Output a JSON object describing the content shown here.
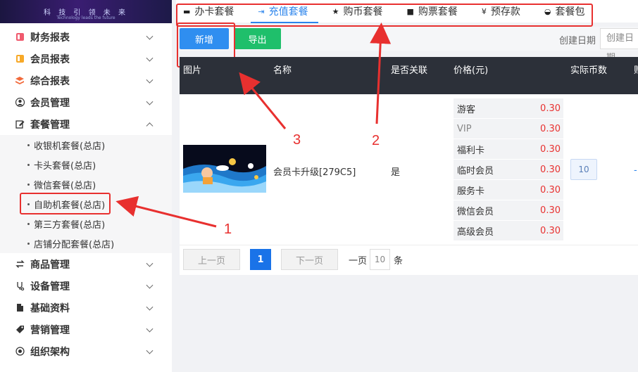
{
  "banner": {
    "title": "科 技 引 领 未 来",
    "subtitle": "Technology leads the future"
  },
  "sidebar": {
    "items": [
      {
        "label": "财务报表",
        "icon": "report-icon"
      },
      {
        "label": "会员报表",
        "icon": "member-report-icon"
      },
      {
        "label": "综合报表",
        "icon": "layers-icon"
      },
      {
        "label": "会员管理",
        "icon": "user-icon"
      },
      {
        "label": "套餐管理",
        "icon": "edit-icon",
        "expanded": true
      }
    ],
    "submenu": [
      "收银机套餐(总店)",
      "卡头套餐(总店)",
      "微信套餐(总店)",
      "自助机套餐(总店)",
      "第三方套餐(总店)",
      "店铺分配套餐(总店)"
    ],
    "items_after": [
      {
        "label": "商品管理",
        "icon": "exchange-icon"
      },
      {
        "label": "设备管理",
        "icon": "device-icon"
      },
      {
        "label": "基础资料",
        "icon": "file-icon"
      },
      {
        "label": "营销管理",
        "icon": "tag-icon"
      },
      {
        "label": "组织架构",
        "icon": "org-icon"
      }
    ]
  },
  "tabs": [
    {
      "label": "办卡套餐",
      "icon": "card-icon"
    },
    {
      "label": "充值套餐",
      "icon": "recharge-icon",
      "active": true
    },
    {
      "label": "购币套餐",
      "icon": "star-icon"
    },
    {
      "label": "购票套餐",
      "icon": "ticket-icon"
    },
    {
      "label": "预存款",
      "icon": "yen-icon"
    },
    {
      "label": "套餐包",
      "icon": "basket-icon"
    }
  ],
  "toolbar": {
    "new_label": "新增",
    "export_label": "导出",
    "date_label": "创建日期",
    "date_placeholder": "创建日期"
  },
  "table": {
    "headers": [
      "图片",
      "名称",
      "是否关联",
      "价格(元)",
      "实际币数",
      "赠"
    ],
    "rows": [
      {
        "name": "会员卡升级[279C5]",
        "linked": "是",
        "prices": [
          {
            "level": "游客",
            "price": "0.30"
          },
          {
            "level": "VIP",
            "price": "0.30"
          },
          {
            "level": "福利卡",
            "price": "0.30"
          },
          {
            "level": "临时会员",
            "price": "0.30"
          },
          {
            "level": "服务卡",
            "price": "0.30"
          },
          {
            "level": "微信会员",
            "price": "0.30"
          },
          {
            "level": "高级会员",
            "price": "0.30"
          }
        ],
        "coins": "10",
        "extra": "-"
      }
    ]
  },
  "pager": {
    "prev": "上一页",
    "current": "1",
    "next": "下一页",
    "per_page_label": "一页",
    "per_page": "10",
    "per_page_unit": "条"
  },
  "annotations": {
    "one": "1",
    "two": "2",
    "three": "3",
    "color": "#e8302f"
  }
}
